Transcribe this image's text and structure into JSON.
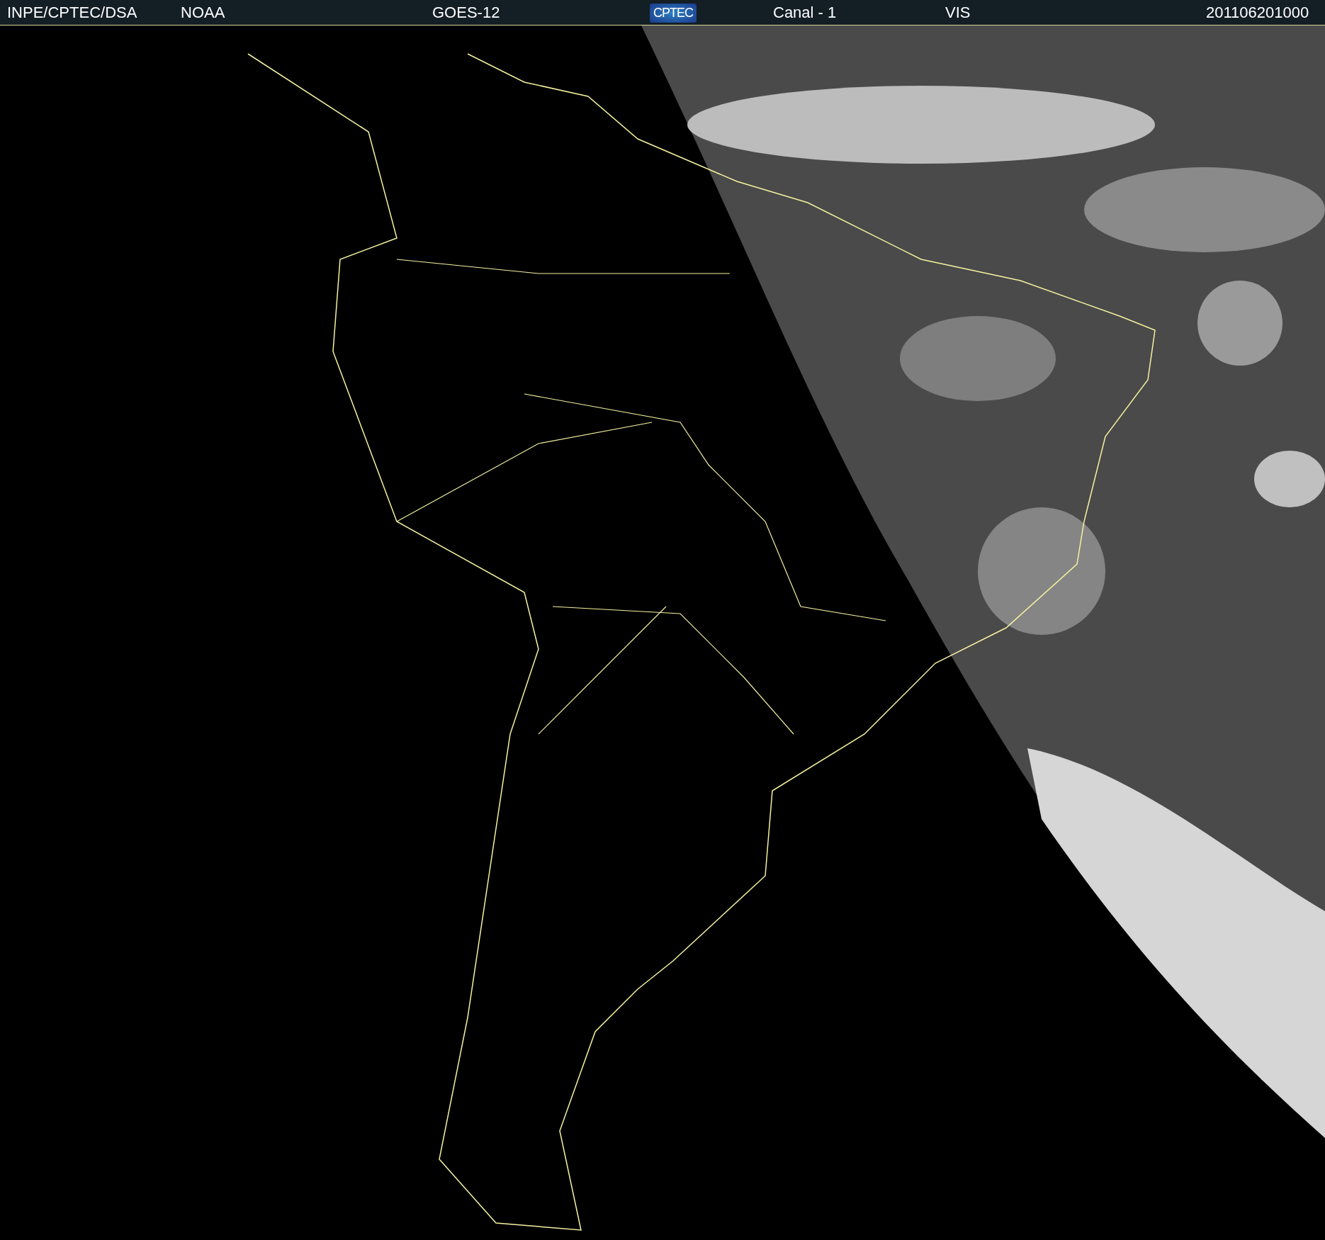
{
  "header": {
    "items": [
      {
        "kind": "text",
        "text": "INPE/CPTEC/DSA"
      },
      {
        "kind": "text",
        "text": "NOAA"
      },
      {
        "kind": "text",
        "text": "GOES-12"
      },
      {
        "kind": "logo",
        "text": "CPTEC"
      },
      {
        "kind": "text",
        "text": "Canal - 1"
      },
      {
        "kind": "text",
        "text": "VIS"
      },
      {
        "kind": "text",
        "text": "201106201000"
      }
    ]
  }
}
